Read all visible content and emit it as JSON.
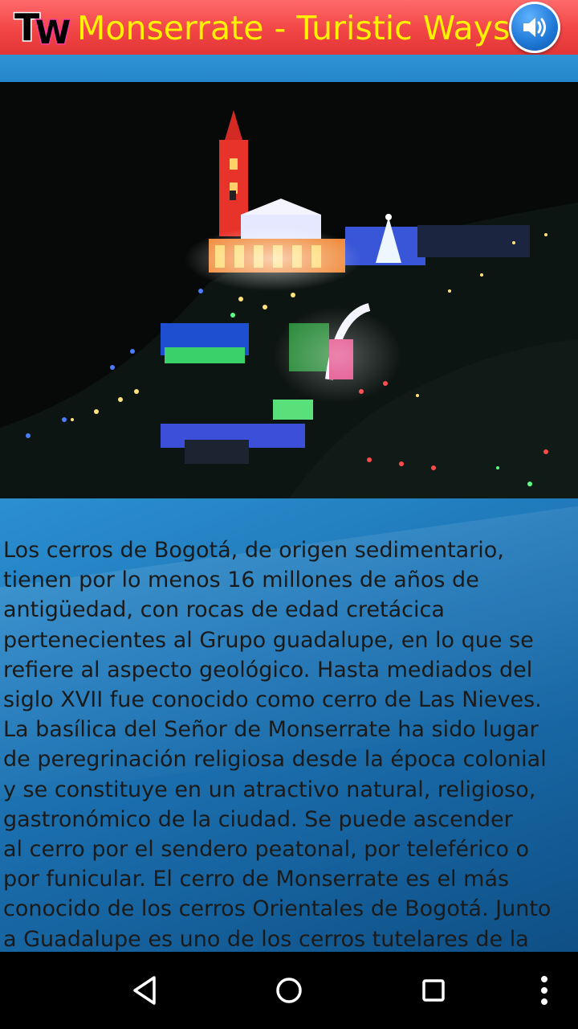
{
  "header": {
    "logo_text": "TW",
    "title": "Monserrate - Turistic Ways",
    "sound_icon": "volume-icon"
  },
  "photo": {
    "subject": "Monserrate at night"
  },
  "content": {
    "description": "Los cerros de Bogotá, de origen sedimentario,\ntienen por lo menos 16 millones de años de\nantigüedad, con rocas de edad cretácica\npertenecientes al Grupo guadalupe, en lo que se\nrefiere al aspecto geológico. Hasta mediados del\nsiglo XVII fue conocido como cerro de Las Nieves.\nLa basílica del Señor de Monserrate ha sido lugar\nde peregrinación religiosa desde la época colonial\ny se constituye en un atractivo natural, religioso,\ngastronómico de la ciudad. Se puede ascender\nal cerro por el sendero peatonal, por teleférico o\npor funicular. El cerro de Monserrate es el más\nconocido de los cerros Orientales de Bogotá. Junto\na Guadalupe es uno de los cerros tutelares de la"
  },
  "navbar": {
    "back_icon": "back-triangle-icon",
    "home_icon": "home-circle-icon",
    "recents_icon": "recents-square-icon",
    "menu_icon": "overflow-menu-icon"
  },
  "colors": {
    "header_red": "#f24545",
    "title_yellow": "#fff200",
    "content_blue": "#1f78b9",
    "navbar_black": "#000000"
  }
}
